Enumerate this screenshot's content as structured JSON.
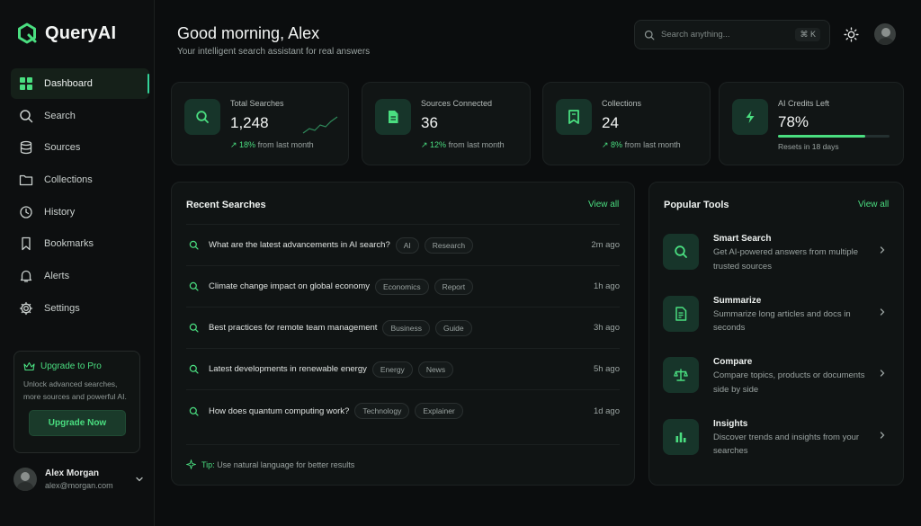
{
  "app": {
    "name": "QueryAI"
  },
  "colors": {
    "accent": "#4ade80",
    "background": "#0b0d0e",
    "card": "#111515"
  },
  "nav": [
    {
      "label": "Dashboard",
      "icon": "grid-icon",
      "active": true
    },
    {
      "label": "Search",
      "icon": "search-icon"
    },
    {
      "label": "Sources",
      "icon": "database-icon"
    },
    {
      "label": "Collections",
      "icon": "folder-icon"
    },
    {
      "label": "History",
      "icon": "clock-icon"
    },
    {
      "label": "Bookmarks",
      "icon": "bookmark-icon"
    },
    {
      "label": "Alerts",
      "icon": "bell-icon"
    },
    {
      "label": "Settings",
      "icon": "gear-icon"
    }
  ],
  "promo": {
    "title": "Upgrade to Pro",
    "description": "Unlock advanced searches, more sources and powerful AI.",
    "button": "Upgrade Now"
  },
  "user": {
    "name": "Alex Morgan",
    "email": "alex@morgan.com"
  },
  "header": {
    "greeting": "Good morning, Alex",
    "subtitle": "Your intelligent search assistant for real answers",
    "search_placeholder": "Search anything...",
    "shortcut": "⌘ K"
  },
  "stats": [
    {
      "label": "Total Searches",
      "value": "1,248",
      "delta": "↗ 18%",
      "delta_text": " from last month",
      "icon": "search-icon"
    },
    {
      "label": "Sources Connected",
      "value": "36",
      "delta": "↗ 12%",
      "delta_text": " from last month",
      "icon": "document-icon"
    },
    {
      "label": "Collections",
      "value": "24",
      "delta": "↗ 8%",
      "delta_text": " from last month",
      "icon": "bookmark-icon"
    },
    {
      "label": "AI Credits Left",
      "value": "78%",
      "progress": 0.78,
      "sub": "Resets in 18 days",
      "icon": "bolt-icon"
    }
  ],
  "recent": {
    "title": "Recent Searches",
    "view_all": "View all",
    "items": [
      {
        "query": "What are the latest advancements in AI search?",
        "tags": [
          "AI",
          "Research"
        ],
        "time": "2m ago"
      },
      {
        "query": "Climate change impact on global economy",
        "tags": [
          "Economics",
          "Report"
        ],
        "time": "1h ago"
      },
      {
        "query": "Best practices for remote team management",
        "tags": [
          "Business",
          "Guide"
        ],
        "time": "3h ago"
      },
      {
        "query": "Latest developments in renewable energy",
        "tags": [
          "Energy",
          "News"
        ],
        "time": "5h ago"
      },
      {
        "query": "How does quantum computing work?",
        "tags": [
          "Technology",
          "Explainer"
        ],
        "time": "1d ago"
      }
    ],
    "tip_label": "Tip:",
    "tip_text": "Use natural language for better results"
  },
  "tools": {
    "title": "Popular Tools",
    "view_all": "View all",
    "items": [
      {
        "name": "Smart Search",
        "desc": "Get AI-powered answers from multiple trusted sources",
        "icon": "search-icon"
      },
      {
        "name": "Summarize",
        "desc": "Summarize long articles and docs in seconds",
        "icon": "summary-doc-icon"
      },
      {
        "name": "Compare",
        "desc": "Compare topics, products or documents side by side",
        "icon": "scale-icon"
      },
      {
        "name": "Insights",
        "desc": "Discover trends and insights from your searches",
        "icon": "bar-chart-icon"
      }
    ]
  }
}
